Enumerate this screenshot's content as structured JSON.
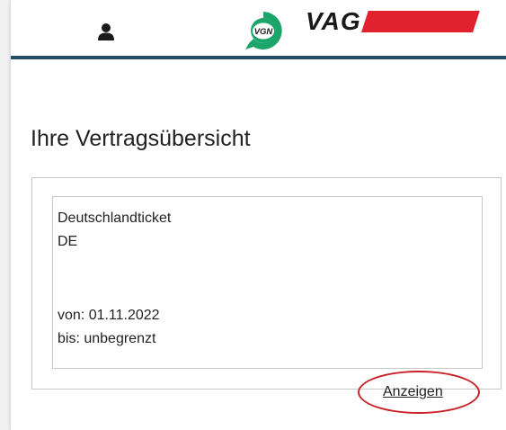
{
  "header": {
    "user_icon": "user-icon",
    "vgn_logo_text": "VGN",
    "vag_logo_text": "VAG",
    "colors": {
      "header_underline": "#1f4e63",
      "vag_red": "#e2212e",
      "vgn_green": "#1aa56a"
    }
  },
  "main": {
    "title": "Ihre Vertragsübersicht",
    "contract": {
      "name": "Deutschlandticket",
      "code": "DE",
      "from": "von: 01.11.2022",
      "until": "bis: unbegrenzt"
    },
    "show_link": "Anzeigen",
    "highlight_color": "#c92128"
  }
}
